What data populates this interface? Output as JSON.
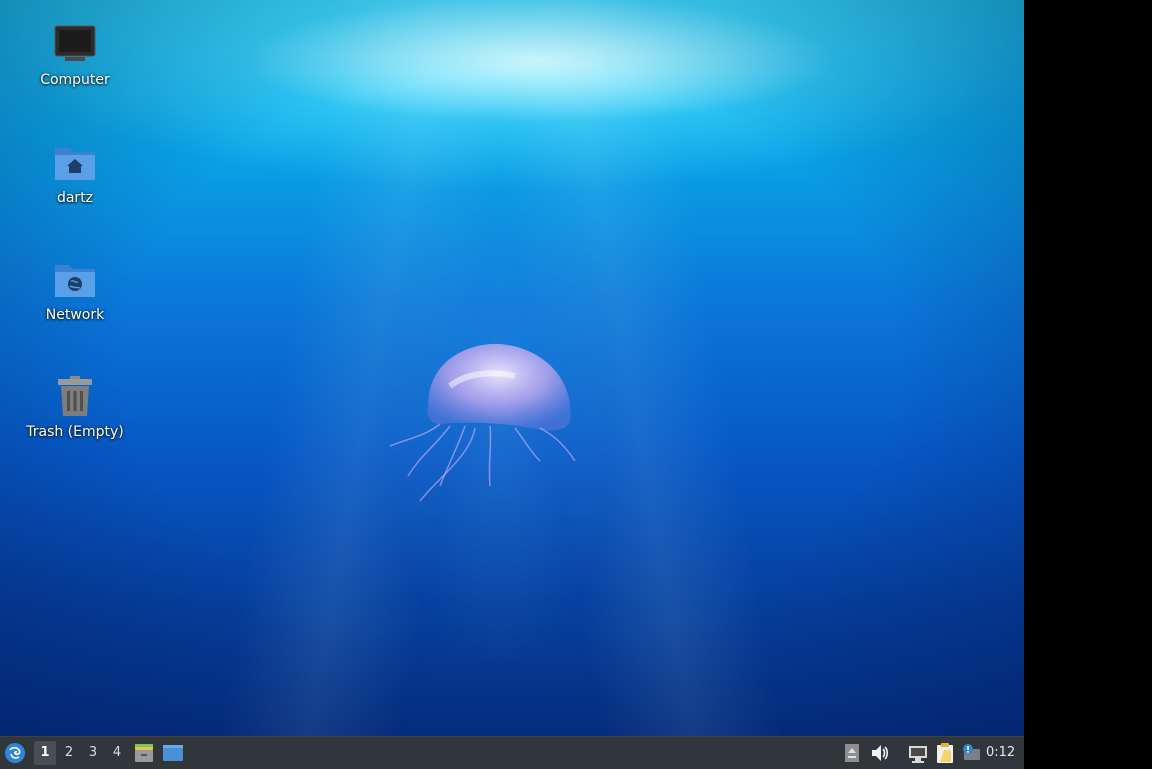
{
  "desktop_icons": [
    {
      "label": "Computer",
      "icon": "computer-icon"
    },
    {
      "label": "dartz",
      "icon": "home-folder-icon"
    },
    {
      "label": "Network",
      "icon": "network-folder-icon"
    },
    {
      "label": "Trash (Empty)",
      "icon": "trash-icon"
    }
  ],
  "panel": {
    "menu_icon": "application-menu-icon",
    "workspaces": [
      "1",
      "2",
      "3",
      "4"
    ],
    "active_workspace": "1",
    "launchers": [
      "file-manager-icon",
      "show-desktop-icon"
    ],
    "tray": [
      "tray-expander-icon",
      "volume-icon",
      "network-wired-icon",
      "clipboard-icon",
      "notifications-icon"
    ],
    "clock": "0:12"
  },
  "colors": {
    "panel_bg": "#31363b",
    "folder_blue": "#4a90d9"
  }
}
